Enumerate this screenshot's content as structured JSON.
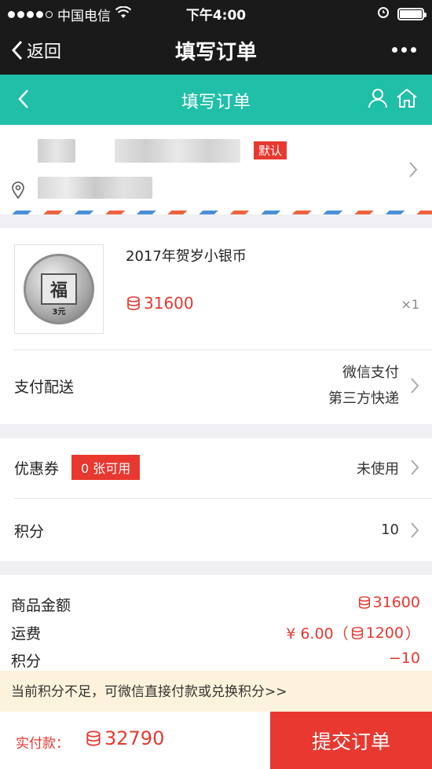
{
  "status_bar": {
    "carrier": "中国电信",
    "time": "下午4:00"
  },
  "wechat_bar": {
    "back_label": "返回",
    "title": "填写订单"
  },
  "nav": {
    "title": "填写订单"
  },
  "address": {
    "default_badge": "默认"
  },
  "product": {
    "name": "2017年贺岁小银币",
    "price": "31600",
    "quantity": "×1",
    "coin_value": "3元"
  },
  "payment": {
    "label": "支付配送",
    "method": "微信支付",
    "shipping": "第三方快递"
  },
  "coupon": {
    "label": "优惠券",
    "badge": "0 张可用",
    "status": "未使用"
  },
  "points": {
    "label": "积分",
    "value": "10"
  },
  "summary": {
    "goods_label": "商品金额",
    "goods_value": "31600",
    "shipping_label": "运费",
    "shipping_prefix": "¥ 6.00（",
    "shipping_points": "1200",
    "shipping_suffix": "）",
    "points_label": "积分",
    "points_value": "−10"
  },
  "notice": "当前积分不足，可微信直接付款或兑换积分>>",
  "footer": {
    "pay_label": "实付款：",
    "pay_amount": "32790",
    "submit_label": "提交订单"
  },
  "colors": {
    "accent_red": "#e8382f",
    "teal": "#1fbfa8",
    "dark_bar": "#1a1a1a"
  }
}
